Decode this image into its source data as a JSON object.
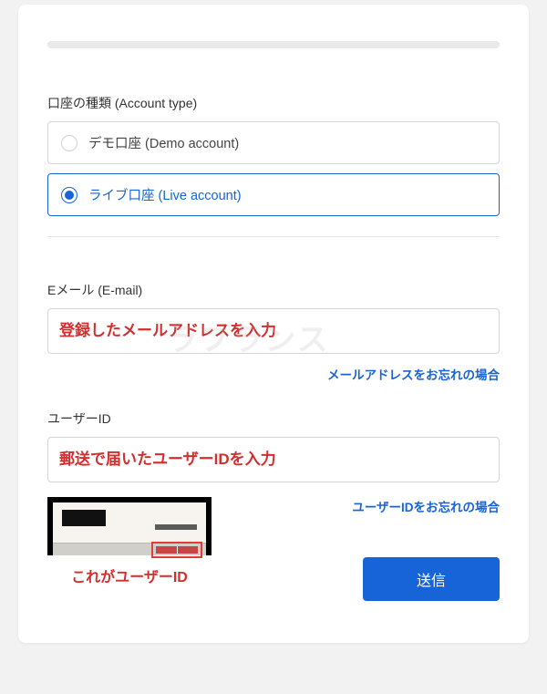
{
  "watermark": "ラフランス",
  "accountType": {
    "label": "口座の種類 (Account type)",
    "demo": "デモ口座 (Demo account)",
    "live": "ライブ口座 (Live account)"
  },
  "email": {
    "label": "Eメール (E-mail)",
    "placeholder": "登録したメールアドレスを入力",
    "forgot": "メールアドレスをお忘れの場合"
  },
  "userId": {
    "label": "ユーザーID",
    "placeholder": "郵送で届いたユーザーIDを入力",
    "forgot": "ユーザーIDをお忘れの場合",
    "imageCaption": "これがユーザーID"
  },
  "submit": "送信"
}
